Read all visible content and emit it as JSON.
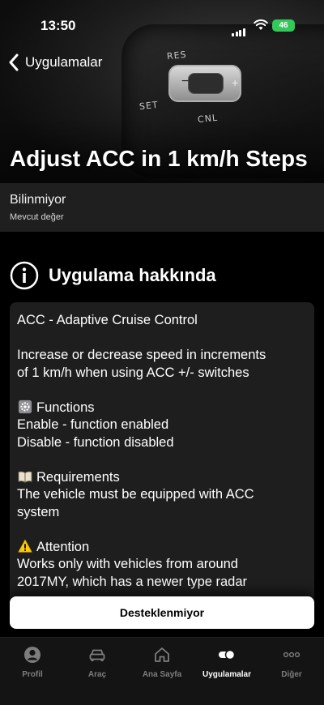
{
  "status_bar": {
    "time": "13:50",
    "battery": "46"
  },
  "nav": {
    "back_label": "Uygulamalar"
  },
  "hero": {
    "labels": {
      "res": "RES",
      "set": "SET",
      "cnl": "CNL"
    }
  },
  "app": {
    "title": "Adjust ACC in 1 km/h Steps"
  },
  "current_value": {
    "value": "Bilinmiyor",
    "caption": "Mevcut değer"
  },
  "about": {
    "heading": "Uygulama hakkında",
    "lines": {
      "l1": "ACC - Adaptive Cruise Control",
      "l2": "Increase or decrease speed in increments",
      "l3": "of 1 km/h when using ACC +/- switches",
      "functions_heading": "Functions",
      "l4": "Enable - function enabled",
      "l5": "Disable - function disabled",
      "requirements_heading": "Requirements",
      "l6": "The vehicle must be equipped with ACC",
      "l7": "system",
      "attention_heading": "Attention",
      "l8": "Works only with vehicles from around",
      "l9": "2017MY, which has a newer type radar"
    }
  },
  "action": {
    "label": "Desteklenmiyor"
  },
  "tabbar": {
    "tabs": [
      {
        "label": "Profil",
        "icon": "person-icon"
      },
      {
        "label": "Araç",
        "icon": "car-icon"
      },
      {
        "label": "Ana Sayfa",
        "icon": "home-icon"
      },
      {
        "label": "Uygulamalar",
        "icon": "toggle-icon",
        "active": true
      },
      {
        "label": "Diğer",
        "icon": "more-icon"
      }
    ]
  }
}
